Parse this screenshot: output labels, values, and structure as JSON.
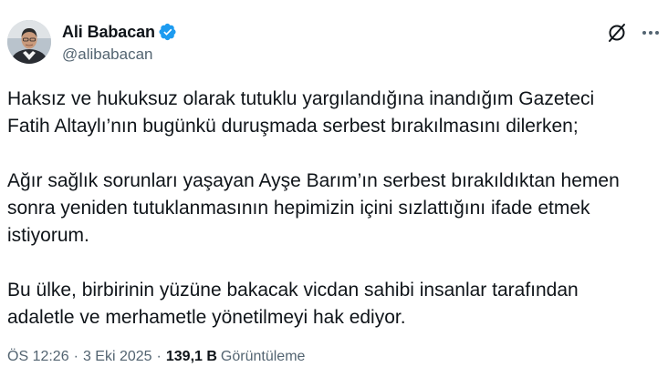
{
  "author": {
    "name": "Ali Babacan",
    "handle": "@alibabacan",
    "verified": true,
    "verified_color": "#1d9bf0"
  },
  "post": {
    "paragraphs": [
      [
        "Haksız ve hukuksuz olarak tutuklu yargılandığına inandığım Gazeteci",
        "Fatih Altaylı’nın bugünkü duruşmada serbest bırakılmasını dilerken;"
      ],
      [
        "Ağır sağlık sorunları yaşayan Ayşe Barım’ın serbest bırakıldıktan hemen",
        "sonra yeniden tutuklanmasının hepimizin içini sızlattığını ifade etmek",
        "istiyorum."
      ],
      [
        "Bu ülke, birbirinin yüzüne bakacak vicdan sahibi insanlar tarafından",
        "adaletle ve merhametle yönetilmeyi hak ediyor."
      ]
    ]
  },
  "meta": {
    "time": "ÖS 12:26",
    "separator": "·",
    "date": "3 Eki 2025",
    "views_count": "139,1 B",
    "views_label": "Görüntüleme"
  },
  "icons": {
    "grok": "grok-icon",
    "more": "more-icon",
    "verified": "verified-badge-icon"
  }
}
